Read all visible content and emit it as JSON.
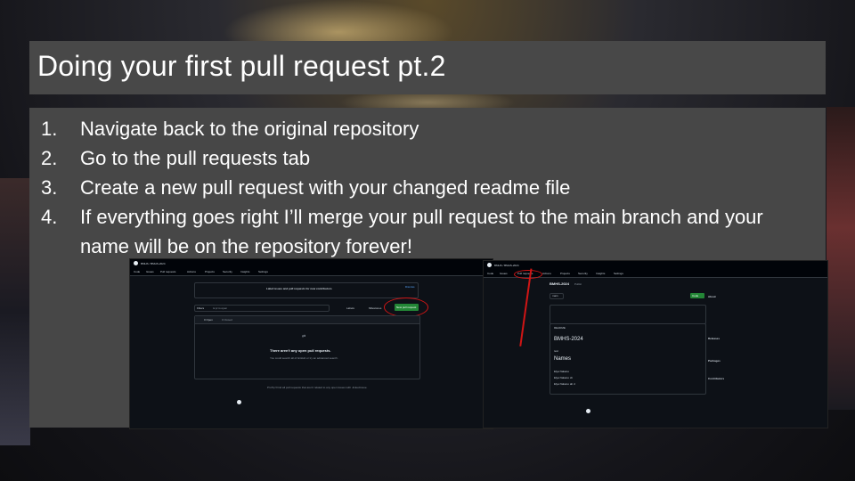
{
  "slide": {
    "title": "Doing your first pull request pt.2",
    "steps": [
      {
        "num": "1.",
        "text": "Navigate back to the original repository"
      },
      {
        "num": "2.",
        "text": "Go to the pull requests tab"
      },
      {
        "num": "3.",
        "text": "Create a new pull request with your changed readme file"
      },
      {
        "num": "4.",
        "text": "If everything goes right I’ll merge your pull request to the main branch and your name will be on the repository forever!"
      }
    ]
  },
  "screenshot_left": {
    "repo_path": "BMHS / BMHS-2024",
    "tabs": [
      "Code",
      "Issues",
      "Pull requests",
      "Actions",
      "Projects",
      "Security",
      "Insights",
      "Settings"
    ],
    "banner_title": "Label issues and pull requests for new contributors",
    "banner_dismiss": "Dismiss",
    "filter_label": "Filters",
    "filter_placeholder": "is:pr is:open",
    "labels_label": "Labels",
    "milestones_label": "Milestones",
    "new_pr_button": "New pull request",
    "open_count": "0 Open",
    "closed_count": "0 Closed",
    "empty_title": "There aren't any open pull requests.",
    "empty_sub": "You could search all of GitHub or try an advanced search.",
    "protip": "ProTip! Find all pull requests that aren't related to any open issues with -linked:issue."
  },
  "screenshot_right": {
    "repo_path": "BMHS / BMHS-2024",
    "repo_title": "BMHS-2024",
    "visibility": "Public",
    "tabs": [
      "Code",
      "Issues",
      "Pull requests",
      "Actions",
      "Projects",
      "Security",
      "Insights",
      "Settings"
    ],
    "branch_label": "main",
    "code_button": "Code",
    "readme_tab": "README",
    "readme_heading": "BMHS-2024",
    "readme_test": "test",
    "names_heading": "Names",
    "names": [
      "Elya Nakano",
      "Elya Nakano xb",
      "Elya Nakano ab d"
    ],
    "about_title": "About",
    "releases_title": "Releases",
    "packages_title": "Packages",
    "contributors_title": "Contributors"
  },
  "colors": {
    "title_bar": "#484848",
    "content_panel": "#474747",
    "annotation_red": "#d01515",
    "gh_green": "#238636"
  }
}
